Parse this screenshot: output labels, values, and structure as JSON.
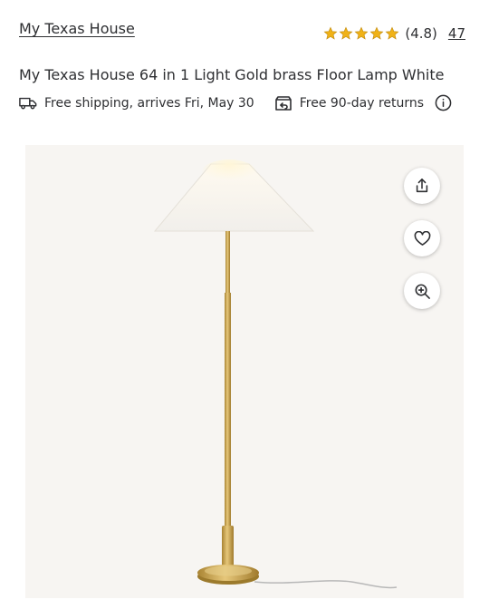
{
  "header": {
    "brand": "My Texas House",
    "rating": {
      "stars": 5,
      "value": "(4.8)",
      "count": "47",
      "star_color": "#f0b217"
    }
  },
  "product": {
    "title": "My Texas House 64 in 1 Light Gold brass Floor Lamp White"
  },
  "perks": {
    "shipping": {
      "icon": "truck-icon",
      "text": "Free shipping, arrives Fri, May 30"
    },
    "returns": {
      "icon": "returns-box-icon",
      "text": "Free 90-day returns"
    },
    "info_icon": "info-icon"
  },
  "image": {
    "alt": "Gold brass floor lamp with white conical shade",
    "actions": [
      "share-icon",
      "heart-icon",
      "zoom-in-icon"
    ]
  },
  "colors": {
    "text": "#2e2f32",
    "star": "#f0b217",
    "image_bg": "#f7f5f2",
    "brass": "#c9a24a"
  }
}
